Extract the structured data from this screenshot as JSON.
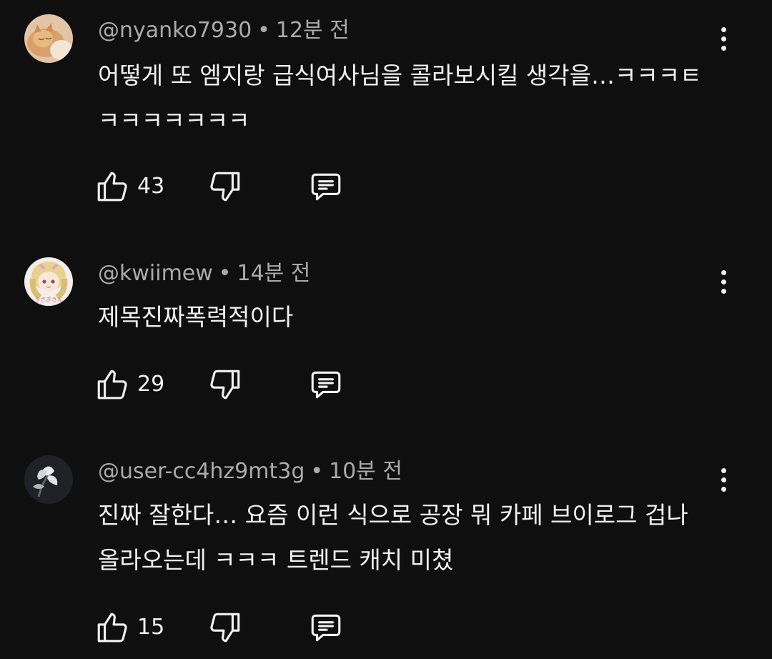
{
  "comments": [
    {
      "handle": "@nyanko7930",
      "separator": "•",
      "time": "12분 전",
      "text": "어떻게 또 엠지랑 급식여사님을 콜라보시킬 생각을…ㅋㅋㅋㅌㅋㅋㅋㅋㅋㅋㅋ",
      "likes": "43",
      "avatar": "cat-photo"
    },
    {
      "handle": "@kwiimew",
      "separator": "•",
      "time": "14분 전",
      "text": "제목진짜폭력적이다",
      "likes": "29",
      "avatar": "anime-girl-うさぎさん"
    },
    {
      "handle": "@user-cc4hz9mt3g",
      "separator": "•",
      "time": "10분 전",
      "text": "진짜 잘한다… 요즘 이런 식으로 공장 뭐 카페 브이로그 겁나 올라오는데 ㅋㅋㅋ 트렌드 캐치 미쳤",
      "likes": "15",
      "avatar": "white-flower-photo"
    }
  ],
  "icons": {
    "like": "thumb-up-icon",
    "dislike": "thumb-down-icon",
    "reply": "reply-icon",
    "more": "more-vert-icon"
  },
  "theme": {
    "background": "#0f0f0f",
    "text": "#f1f1f1",
    "meta": "#aaaaaa"
  }
}
